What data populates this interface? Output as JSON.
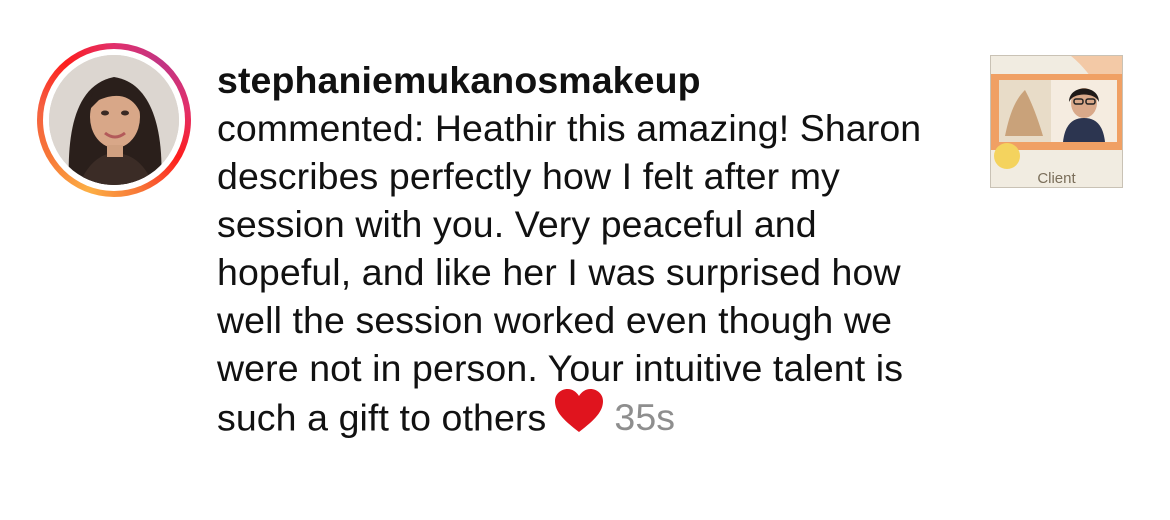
{
  "notification": {
    "username": "stephaniemukanosmakeup",
    "action": "commented:",
    "comment_text": "Heathir this amazing! Sharon describes perfectly how I felt after my session with you. Very peaceful and hopeful, and like her I was surprised how well the session worked even though we were not in person. Your intuitive talent is such a gift to others",
    "emoji": "heart-icon",
    "timestamp": "35s"
  },
  "post_thumbnail": {
    "label": "Client"
  },
  "colors": {
    "timestamp": "#8e8e8e",
    "heart": "#e0141e",
    "story_ring_start": "#fcaf45",
    "story_ring_end": "#c13584",
    "thumb_orange": "#f0a064"
  }
}
